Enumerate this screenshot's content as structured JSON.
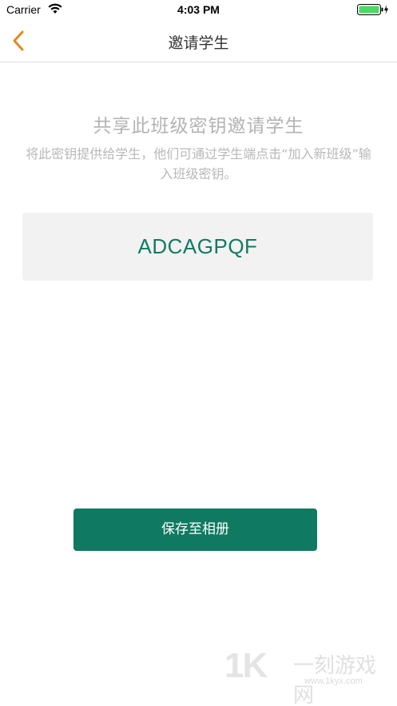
{
  "status_bar": {
    "carrier": "Carrier",
    "time": "4:03 PM",
    "wifi_icon": "wifi-icon",
    "battery_icon": "battery-icon",
    "battery_color": "#4cd964"
  },
  "nav": {
    "title": "邀请学生",
    "back_icon": "chevron-left-icon",
    "back_color": "#e08a1e"
  },
  "content": {
    "headline": "共享此班级密钥邀请学生",
    "description": "将此密钥提供给学生，他们可通过学生端点击“加入新班级”输入班级密钥。",
    "class_key": "ADCAGPQF",
    "key_color": "#127a63"
  },
  "actions": {
    "save_label": "保存至相册",
    "button_color": "#0f7a61"
  },
  "watermark": {
    "logo": "1K",
    "name": "一刻游戏网",
    "url": "www.1kyx.com"
  }
}
